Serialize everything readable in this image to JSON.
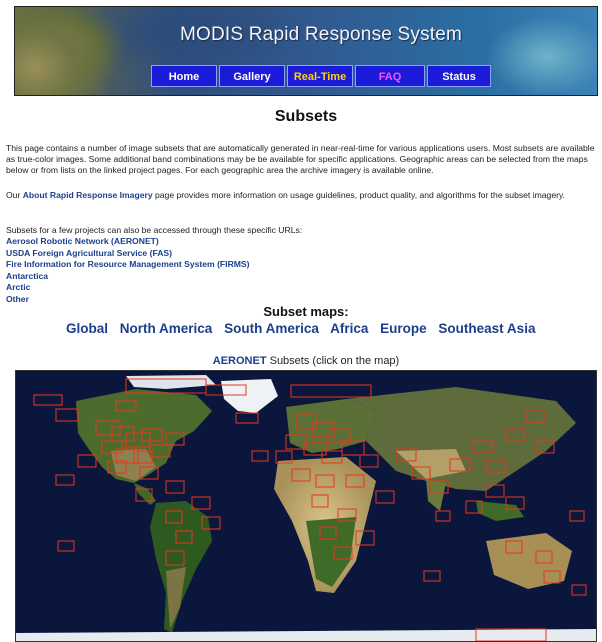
{
  "header": {
    "title": "MODIS Rapid Response System",
    "nav": [
      {
        "label": "Home",
        "state": "normal"
      },
      {
        "label": "Gallery",
        "state": "normal"
      },
      {
        "label": "Real-Time",
        "state": "active"
      },
      {
        "label": "FAQ",
        "state": "faq"
      },
      {
        "label": "Status",
        "state": "normal"
      }
    ]
  },
  "page": {
    "title": "Subsets",
    "intro": "This page contains a number of image subsets that are automatically generated in near-real-time for various applications users. Most subsets are available as true-color images. Some additional band combinations may be be available for specific applications. Geographic areas can be selected from the maps below or from lists on the linked project pages. For each geographic area the archive imagery is available online.",
    "about_prefix": "Our ",
    "about_link": "About Rapid Response Imagery",
    "about_suffix": " page provides more information on usage guidelines, product quality, and algorithms for the subset imagery.",
    "projects_intro": "Subsets for a few projects can also be accessed through these specific URLs:",
    "projects": [
      "Aerosol Robotic Network (AERONET)",
      "USDA Foreign Agricultural Service (FAS)",
      "Fire Information for Resource Management System (FIRMS)",
      "Antarctica",
      "Arctic",
      "Other"
    ],
    "subset_maps_heading": "Subset maps:",
    "regions": [
      "Global",
      "North America",
      "South America",
      "Africa",
      "Europe",
      "Southeast Asia"
    ],
    "map_caption_link": "AERONET",
    "map_caption_text": " Subsets (click on the map)"
  },
  "colors": {
    "nav_bg": "#1b1bd9",
    "nav_active": "#ffd400",
    "nav_faq": "#ff4fff",
    "link": "#1b3f8c",
    "map_ocean": "#0b163d",
    "subset_box": "#e8361c"
  }
}
